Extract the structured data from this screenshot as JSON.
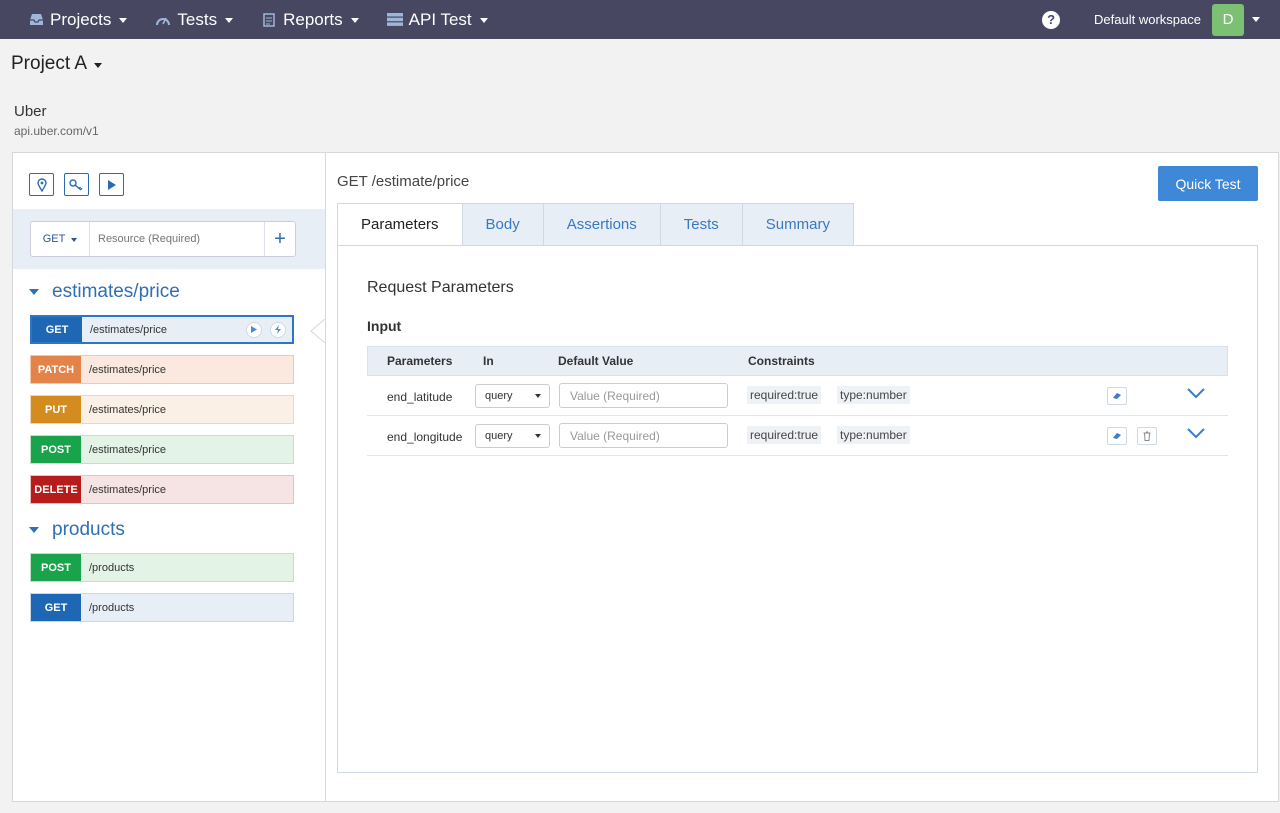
{
  "nav": {
    "items": [
      {
        "label": "Projects",
        "icon": "inbox-icon"
      },
      {
        "label": "Tests",
        "icon": "gauge-icon"
      },
      {
        "label": "Reports",
        "icon": "document-icon"
      },
      {
        "label": "API Test",
        "icon": "server-icon"
      }
    ],
    "workspace": "Default workspace",
    "avatar_initial": "D",
    "help": "?"
  },
  "project": {
    "title": "Project A",
    "api_name": "Uber",
    "api_url": "api.uber.com/v1"
  },
  "sidebar": {
    "add": {
      "method": "GET",
      "placeholder": "Resource (Required)",
      "plus": "+"
    },
    "groups": [
      {
        "title": "estimates/price",
        "endpoints": [
          {
            "method": "GET",
            "path": "/estimates/price"
          },
          {
            "method": "PATCH",
            "path": "/estimates/price"
          },
          {
            "method": "PUT",
            "path": "/estimates/price"
          },
          {
            "method": "POST",
            "path": "/estimates/price"
          },
          {
            "method": "DELETE",
            "path": "/estimates/price"
          }
        ]
      },
      {
        "title": "products",
        "endpoints": [
          {
            "method": "POST",
            "path": "/products"
          },
          {
            "method": "GET",
            "path": "/products"
          }
        ]
      }
    ]
  },
  "content": {
    "request_title": "GET /estimate/price",
    "quick_test": "Quick Test",
    "tabs": [
      "Parameters",
      "Body",
      "Assertions",
      "Tests",
      "Summary"
    ],
    "active_tab": "Parameters",
    "section_title": "Request Parameters",
    "input_label": "Input",
    "table": {
      "headers": [
        "Parameters",
        "In",
        "Default Value",
        "Constraints"
      ],
      "rows": [
        {
          "name": "end_latitude",
          "in": "query",
          "placeholder": "Value (Required)",
          "constraints": [
            "required:true",
            "type:number"
          ]
        },
        {
          "name": "end_longitude",
          "in": "query",
          "placeholder": "Value (Required)",
          "constraints": [
            "required:true",
            "type:number"
          ]
        }
      ]
    }
  },
  "colors": {
    "nav_bg": "#474762",
    "get": "#1d67b5",
    "patch": "#e38349",
    "put": "#d58c1f",
    "post": "#19a34a",
    "delete": "#b71c1c",
    "accent": "#3f88d8"
  }
}
